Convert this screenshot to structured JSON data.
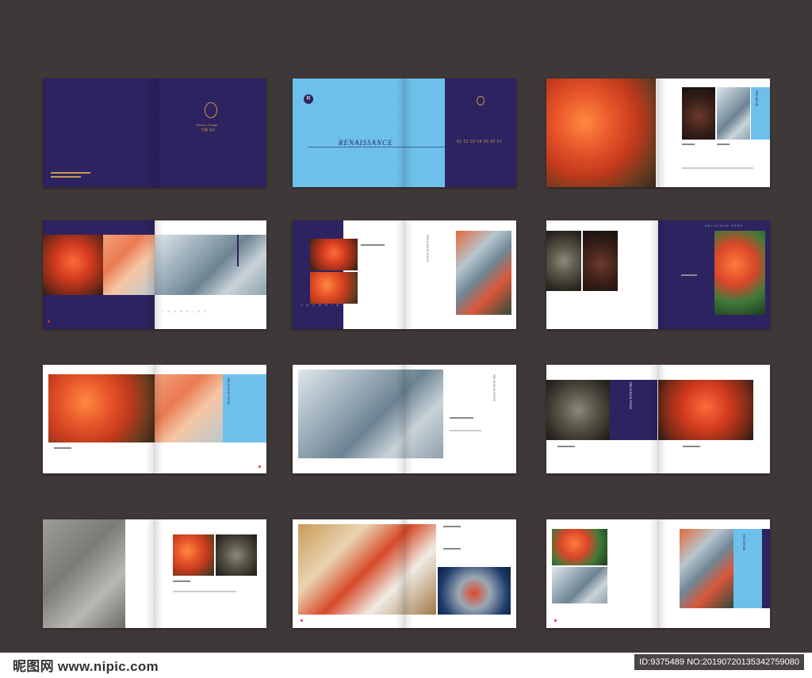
{
  "footer": {
    "site": "昵图网 www.nipic.com",
    "id": "ID:9375489 NO:20190720135342759080"
  },
  "spreads": {
    "s1": {
      "brand_cn": "尔源·设计",
      "brand_en": "Wuman Design"
    },
    "s2": {
      "badge": "R",
      "title": "RENAISSANCE",
      "numbers": "01 02 03 04 05 06 07"
    },
    "s3": {
      "vertical": "THE BRINE"
    },
    "s4": {
      "watermark": "T H E B R I N E"
    },
    "s5": {
      "watermark": "T H E B R I N E",
      "vertical": "DELICIOUS FOOD"
    },
    "s6": {
      "watermark": "DELICIOUS FOOD"
    },
    "s7": {
      "vertical": "DELICIOUS FOOD"
    },
    "s8": {
      "vertical": "DELICIOUS FOOD"
    },
    "s9": {
      "vertical": "DELICIOUS FOOD"
    },
    "s12": {
      "vertical": "THE BRINE"
    }
  },
  "colors": {
    "purple": "#2d2360",
    "light_blue": "#6ec0ec",
    "background": "#3e3838"
  }
}
